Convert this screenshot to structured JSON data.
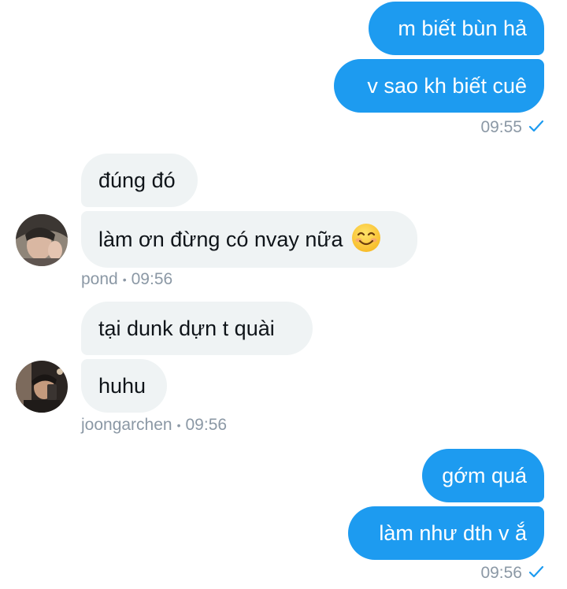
{
  "conversation": {
    "group1_out": {
      "messages": [
        "m biết bùn hả",
        "v sao kh biết cuê"
      ],
      "time": "09:55",
      "read_icon": "check-icon"
    },
    "group2_in": {
      "messages": [
        "đúng đó",
        "làm ơn đừng có nvay nữa"
      ],
      "emoji": "smiling-face-emoji",
      "sender": "pond",
      "separator": "•",
      "time": "09:56"
    },
    "group3_in": {
      "messages": [
        "tại dunk dựn t quài",
        "huhu"
      ],
      "sender": "joongarchen",
      "separator": "•",
      "time": "09:56"
    },
    "group4_out": {
      "messages": [
        "gớm quá",
        "làm như dth v ắ"
      ],
      "time": "09:56",
      "read_icon": "check-icon"
    }
  },
  "colors": {
    "outgoing_bubble": "#1d9bf0",
    "incoming_bubble": "#eff3f4",
    "meta_text": "#8b98a5",
    "check": "#1d9bf0"
  }
}
